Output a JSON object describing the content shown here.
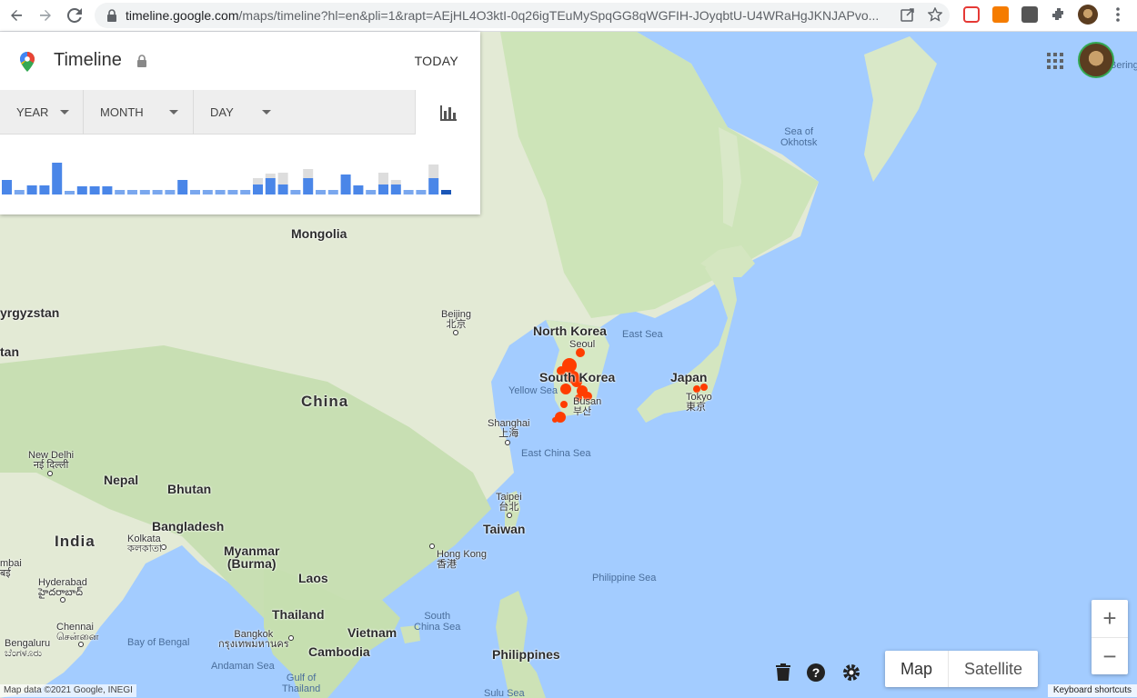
{
  "browser": {
    "url_host": "timeline.google.com",
    "url_rest": "/maps/timeline?hl=en&pli=1&rapt=AEjHL4O3ktI-0q26igTEuMySpqGG8qWGFIH-JOyqbtU-U4WRaHgJKNJAPvo...",
    "icons": [
      "back-icon",
      "forward-icon",
      "reload-icon",
      "lock-icon",
      "share-icon",
      "star-icon",
      "extensions-icon",
      "menu-icon"
    ]
  },
  "timeline": {
    "title": "Timeline",
    "today_label": "TODAY",
    "filters": {
      "year": "YEAR",
      "month": "MONTH",
      "day": "DAY"
    },
    "histogram": [
      {
        "v": 16,
        "g": 0
      },
      {
        "v": 5,
        "g": 0
      },
      {
        "v": 10,
        "g": 0
      },
      {
        "v": 10,
        "g": 0
      },
      {
        "v": 35,
        "g": 0
      },
      {
        "v": 4,
        "g": 0
      },
      {
        "v": 9,
        "g": 0
      },
      {
        "v": 9,
        "g": 0
      },
      {
        "v": 9,
        "g": 0
      },
      {
        "v": 5,
        "g": 0
      },
      {
        "v": 5,
        "g": 0
      },
      {
        "v": 5,
        "g": 0
      },
      {
        "v": 5,
        "g": 0
      },
      {
        "v": 5,
        "g": 0
      },
      {
        "v": 16,
        "g": 0
      },
      {
        "v": 5,
        "g": 0
      },
      {
        "v": 5,
        "g": 0
      },
      {
        "v": 5,
        "g": 0
      },
      {
        "v": 5,
        "g": 0
      },
      {
        "v": 5,
        "g": 0
      },
      {
        "v": 11,
        "g": 7
      },
      {
        "v": 18,
        "g": 5
      },
      {
        "v": 11,
        "g": 13
      },
      {
        "v": 5,
        "g": 0
      },
      {
        "v": 18,
        "g": 10
      },
      {
        "v": 5,
        "g": 0
      },
      {
        "v": 5,
        "g": 0
      },
      {
        "v": 22,
        "g": 0
      },
      {
        "v": 10,
        "g": 0
      },
      {
        "v": 5,
        "g": 0
      },
      {
        "v": 11,
        "g": 13
      },
      {
        "v": 11,
        "g": 5
      },
      {
        "v": 5,
        "g": 0
      },
      {
        "v": 5,
        "g": 0
      },
      {
        "v": 18,
        "g": 15
      },
      {
        "v": 5,
        "g": 0,
        "dark": true
      }
    ]
  },
  "map": {
    "countries": [
      {
        "name": "Mongolia"
      },
      {
        "name": "China"
      },
      {
        "name": "North Korea"
      },
      {
        "name": "South Korea"
      },
      {
        "name": "Japan"
      },
      {
        "name": "Nepal"
      },
      {
        "name": "Bhutan"
      },
      {
        "name": "Bangladesh"
      },
      {
        "name": "India"
      },
      {
        "name": "Myanmar\n(Burma)"
      },
      {
        "name": "Laos"
      },
      {
        "name": "Thailand"
      },
      {
        "name": "Vietnam"
      },
      {
        "name": "Cambodia"
      },
      {
        "name": "Taiwan"
      },
      {
        "name": "Philippines"
      },
      {
        "name": "yrgyzstan"
      },
      {
        "name": "tan"
      }
    ],
    "cities": [
      {
        "name": "Beijing\n北京"
      },
      {
        "name": "Seoul"
      },
      {
        "name": "Busan\n부산"
      },
      {
        "name": "Tokyo\n東京"
      },
      {
        "name": "Shanghai\n上海"
      },
      {
        "name": "Taipei\n台北"
      },
      {
        "name": "Hong Kong\n香港"
      },
      {
        "name": "New Delhi\nनई दिल्ली"
      },
      {
        "name": "Kolkata\nকলকাতা"
      },
      {
        "name": "Hyderabad\nహైదరాబాద్"
      },
      {
        "name": "Chennai\nசென்னை"
      },
      {
        "name": "Bengaluru\nಬೆಂಗಳೂರು"
      },
      {
        "name": "Bangkok\nกรุงเทพมหานคร"
      },
      {
        "name": "mbai\nबई"
      }
    ],
    "seas": [
      {
        "name": "Sea of\nOkhotsk"
      },
      {
        "name": "East Sea"
      },
      {
        "name": "Yellow Sea"
      },
      {
        "name": "East China Sea"
      },
      {
        "name": "Philippine Sea"
      },
      {
        "name": "South\nChina Sea"
      },
      {
        "name": "Bay of Bengal"
      },
      {
        "name": "Andaman Sea"
      },
      {
        "name": "Gulf of\nThailand"
      },
      {
        "name": "Sulu Sea"
      },
      {
        "name": "Bering"
      }
    ],
    "attribution": "Map data ©2021 Google, INEGI",
    "shortcuts": "Keyboard shortcuts",
    "location_color": "#ff3d00"
  },
  "controls": {
    "map_type": {
      "map": "Map",
      "satellite": "Satellite"
    },
    "zoom_in": "+",
    "zoom_out": "−"
  }
}
